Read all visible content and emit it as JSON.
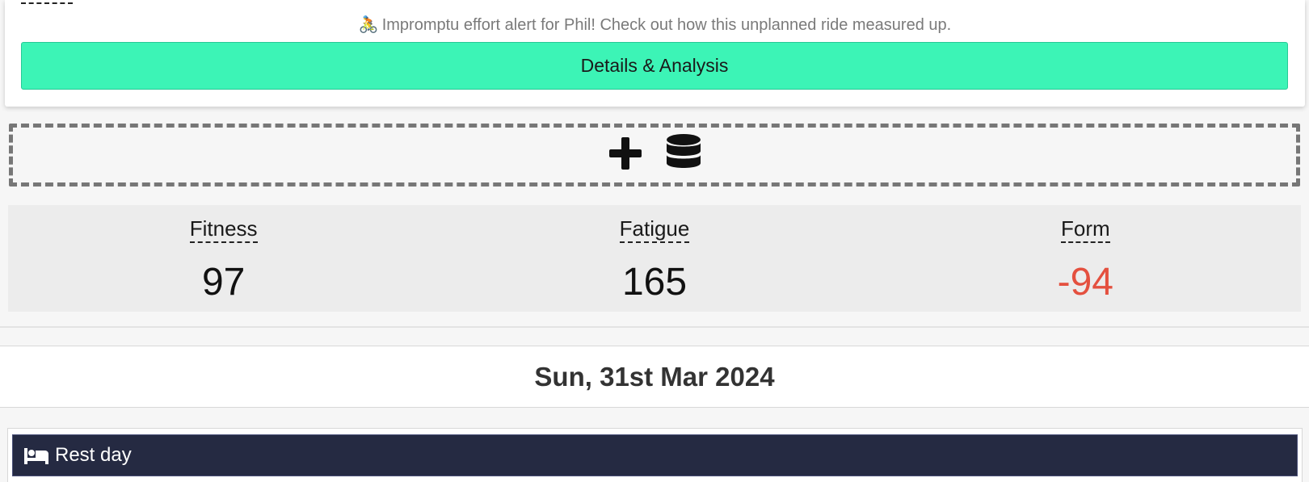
{
  "activity": {
    "alert_emoji": "🚴",
    "alert_text": "Impromptu effort alert for Phil! Check out how this unplanned ride measured up.",
    "details_button": "Details & Analysis"
  },
  "upload": {
    "icons": [
      "plus-icon",
      "database-icon"
    ]
  },
  "metrics": [
    {
      "label": "Fitness",
      "value": "97"
    },
    {
      "label": "Fatigue",
      "value": "165"
    },
    {
      "label": "Form",
      "value": "-94"
    }
  ],
  "day": {
    "date": "Sun, 31st Mar 2024",
    "rest_label": "Rest day",
    "rest_icon": "bed-icon"
  },
  "colors": {
    "button": "#3cf4b6",
    "negative": "#e4503f",
    "rest_bar": "#252a42"
  }
}
